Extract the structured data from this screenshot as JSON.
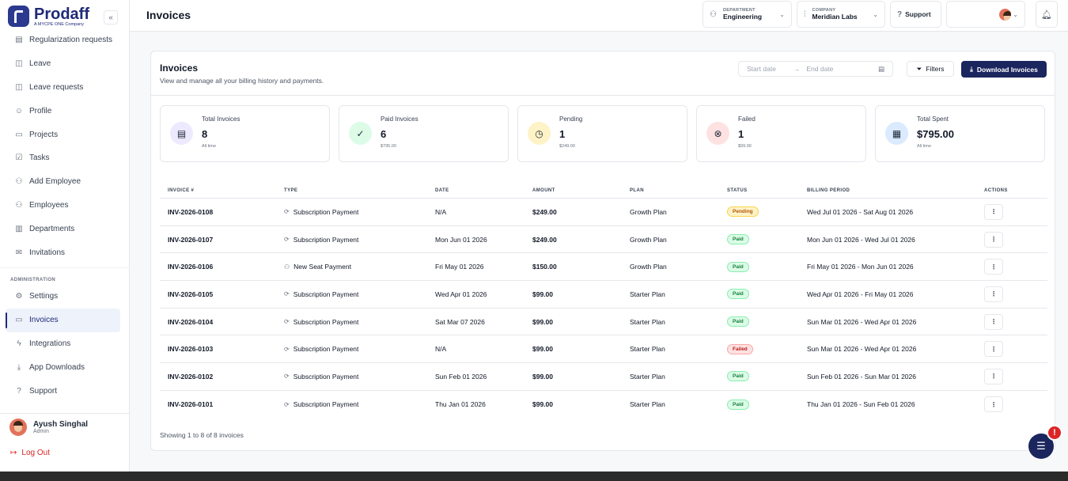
{
  "brand": {
    "name": "Prodaff",
    "sub": "A MYCPE ONE Company"
  },
  "sidebar": {
    "items": [
      {
        "label": "Regularization requests",
        "icon": "document-icon"
      },
      {
        "label": "Leave",
        "icon": "briefcase-icon"
      },
      {
        "label": "Leave requests",
        "icon": "briefcase-icon"
      },
      {
        "label": "Profile",
        "icon": "user-icon"
      },
      {
        "label": "Projects",
        "icon": "folder-icon"
      },
      {
        "label": "Tasks",
        "icon": "checkbox-icon"
      },
      {
        "label": "Add Employee",
        "icon": "user-plus-icon"
      },
      {
        "label": "Employees",
        "icon": "users-icon"
      },
      {
        "label": "Departments",
        "icon": "building-icon"
      },
      {
        "label": "Invitations",
        "icon": "mail-icon"
      }
    ],
    "admin_section": "ADMINISTRATION",
    "admin_items": [
      {
        "label": "Settings",
        "icon": "gear-icon"
      },
      {
        "label": "Invoices",
        "icon": "card-icon",
        "active": true
      },
      {
        "label": "Integrations",
        "icon": "bolt-icon"
      },
      {
        "label": "App Downloads",
        "icon": "download-icon"
      },
      {
        "label": "Support",
        "icon": "help-icon"
      }
    ],
    "user": {
      "name": "Ayush Singhal",
      "role": "Admin"
    },
    "logout": "Log Out"
  },
  "topbar": {
    "title": "Invoices",
    "department_label": "DEPARTMENT",
    "department_value": "Engineering",
    "company_label": "COMPANY",
    "company_value": "Meridian Labs",
    "support": "Support"
  },
  "card": {
    "title": "Invoices",
    "subtitle": "View and manage all your billing history and payments.",
    "start_placeholder": "Start date",
    "end_placeholder": "End date",
    "filters": "Filters",
    "download": "Download Invoices"
  },
  "stats": [
    {
      "label": "Total Invoices",
      "value": "8",
      "sub": "All time",
      "color": "#ede9fe",
      "icon": "document-icon"
    },
    {
      "label": "Paid Invoices",
      "value": "6",
      "sub": "$795.00",
      "color": "#dcfce7",
      "icon": "check-circle-icon"
    },
    {
      "label": "Pending",
      "value": "1",
      "sub": "$249.00",
      "color": "#fef3c7",
      "icon": "clock-icon"
    },
    {
      "label": "Failed",
      "value": "1",
      "sub": "$99.00",
      "color": "#fee2e2",
      "icon": "x-circle-icon"
    },
    {
      "label": "Total Spent",
      "value": "$795.00",
      "sub": "All time",
      "color": "#dbeafe",
      "icon": "calendar-icon"
    }
  ],
  "table": {
    "headers": [
      "INVOICE #",
      "TYPE",
      "DATE",
      "AMOUNT",
      "PLAN",
      "STATUS",
      "BILLING PERIOD",
      "ACTIONS"
    ],
    "rows": [
      {
        "id": "INV-2026-0108",
        "type": "Subscription Payment",
        "date": "N/A",
        "amount": "$249.00",
        "plan": "Growth Plan",
        "status": "Pending",
        "period": "Wed Jul 01 2026 - Sat Aug 01 2026"
      },
      {
        "id": "INV-2026-0107",
        "type": "Subscription Payment",
        "date": "Mon Jun 01 2026",
        "amount": "$249.00",
        "plan": "Growth Plan",
        "status": "Paid",
        "period": "Mon Jun 01 2026 - Wed Jul 01 2026"
      },
      {
        "id": "INV-2026-0106",
        "type": "New Seat Payment",
        "date": "Fri May 01 2026",
        "amount": "$150.00",
        "plan": "Growth Plan",
        "status": "Paid",
        "period": "Fri May 01 2026 - Mon Jun 01 2026"
      },
      {
        "id": "INV-2026-0105",
        "type": "Subscription Payment",
        "date": "Wed Apr 01 2026",
        "amount": "$99.00",
        "plan": "Starter Plan",
        "status": "Paid",
        "period": "Wed Apr 01 2026 - Fri May 01 2026"
      },
      {
        "id": "INV-2026-0104",
        "type": "Subscription Payment",
        "date": "Sat Mar 07 2026",
        "amount": "$99.00",
        "plan": "Starter Plan",
        "status": "Paid",
        "period": "Sun Mar 01 2026 - Wed Apr 01 2026"
      },
      {
        "id": "INV-2026-0103",
        "type": "Subscription Payment",
        "date": "N/A",
        "amount": "$99.00",
        "plan": "Starter Plan",
        "status": "Failed",
        "period": "Sun Mar 01 2026 - Wed Apr 01 2026"
      },
      {
        "id": "INV-2026-0102",
        "type": "Subscription Payment",
        "date": "Sun Feb 01 2026",
        "amount": "$99.00",
        "plan": "Starter Plan",
        "status": "Paid",
        "period": "Sun Feb 01 2026 - Sun Mar 01 2026"
      },
      {
        "id": "INV-2026-0101",
        "type": "Subscription Payment",
        "date": "Thu Jan 01 2026",
        "amount": "$99.00",
        "plan": "Starter Plan",
        "status": "Paid",
        "period": "Thu Jan 01 2026 - Sun Feb 01 2026"
      }
    ],
    "footer": "Showing 1 to 8 of 8 invoices"
  }
}
